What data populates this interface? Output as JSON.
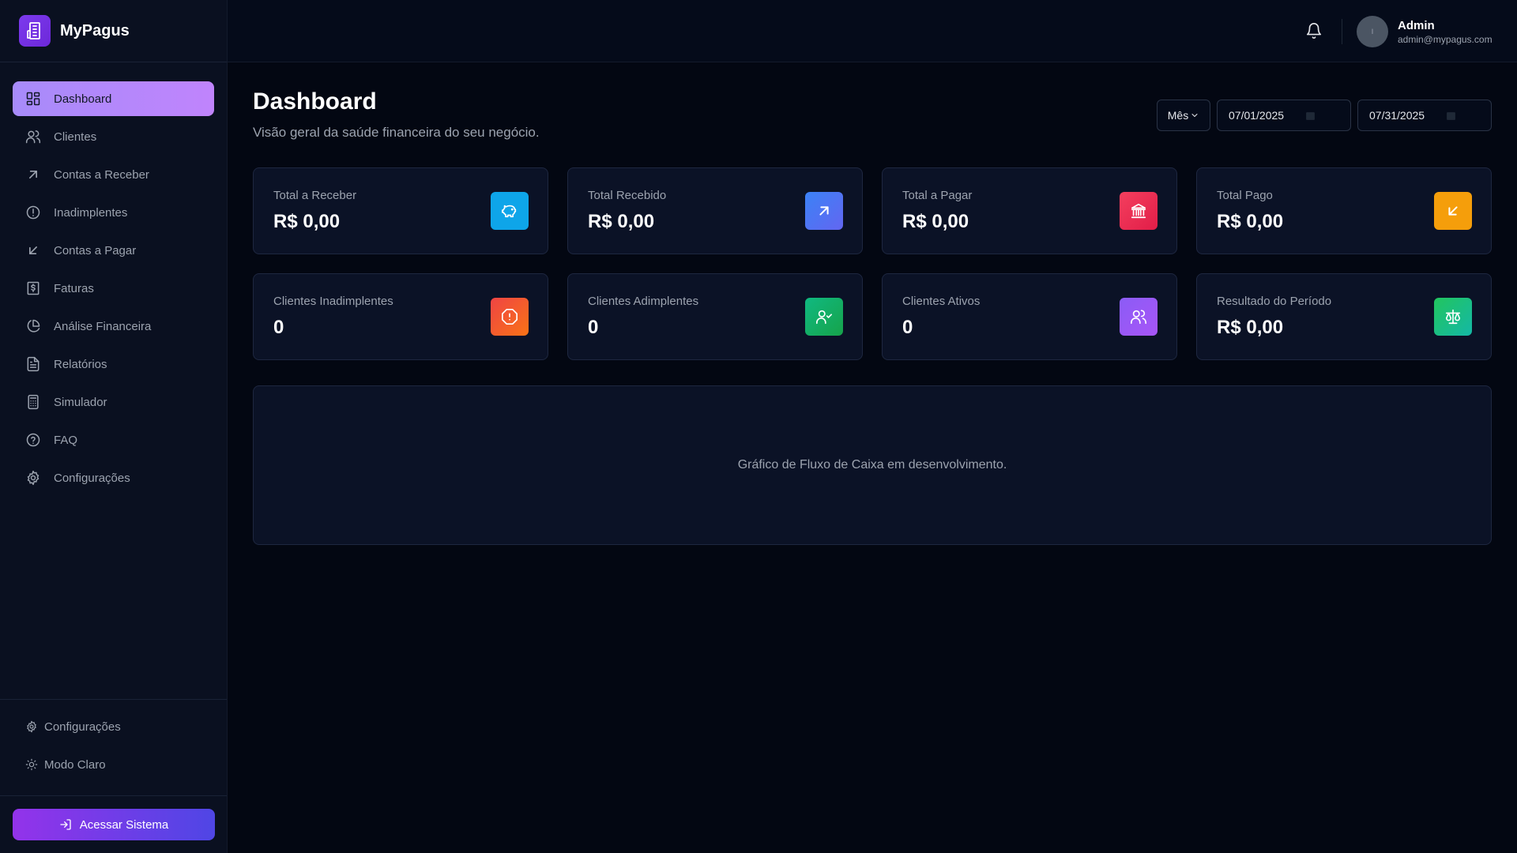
{
  "brand": {
    "name": "MyPagus",
    "icon": "building-icon"
  },
  "sidebar": {
    "items": [
      {
        "label": "Dashboard",
        "icon": "dashboard-icon",
        "active": true
      },
      {
        "label": "Clientes",
        "icon": "users-icon"
      },
      {
        "label": "Contas a Receber",
        "icon": "arrow-up-right-icon"
      },
      {
        "label": "Inadimplentes",
        "icon": "alert-circle-icon"
      },
      {
        "label": "Contas a Pagar",
        "icon": "arrow-down-left-icon"
      },
      {
        "label": "Faturas",
        "icon": "invoice-dollar-icon"
      },
      {
        "label": "Análise Financeira",
        "icon": "pie-chart-icon"
      },
      {
        "label": "Relatórios",
        "icon": "file-text-icon"
      },
      {
        "label": "Simulador",
        "icon": "calculator-icon"
      },
      {
        "label": "FAQ",
        "icon": "help-circle-icon"
      },
      {
        "label": "Configurações",
        "icon": "gear-icon"
      }
    ],
    "footer": [
      {
        "label": "Configurações",
        "icon": "gear-icon"
      },
      {
        "label": "Modo Claro",
        "icon": "sun-icon"
      }
    ],
    "access_button": "Acessar Sistema"
  },
  "header": {
    "user_name": "Admin",
    "user_email": "admin@mypagus.com",
    "avatar_text": "I"
  },
  "page": {
    "title": "Dashboard",
    "subtitle": "Visão geral da saúde financeira do seu negócio.",
    "period_select": "Mês",
    "date_start": "07/01/2025",
    "date_end": "07/31/2025"
  },
  "cards": [
    {
      "label": "Total a Receber",
      "value": "R$ 0,00",
      "icon": "piggy-bank-icon",
      "color": "#0ea5e9"
    },
    {
      "label": "Total Recebido",
      "value": "R$ 0,00",
      "icon": "arrow-up-right-icon",
      "color": "#4f6ef7"
    },
    {
      "label": "Total a Pagar",
      "value": "R$ 0,00",
      "icon": "bank-icon",
      "color": "#f43f5e"
    },
    {
      "label": "Total Pago",
      "value": "R$ 0,00",
      "icon": "arrow-down-left-icon",
      "color": "#f59e0b"
    },
    {
      "label": "Clientes Inadimplentes",
      "value": "0",
      "icon": "alert-octagon-icon",
      "color": "#f4512c"
    },
    {
      "label": "Clientes Adimplentes",
      "value": "0",
      "icon": "user-check-icon",
      "color": "#10b981"
    },
    {
      "label": "Clientes Ativos",
      "value": "0",
      "icon": "users-icon",
      "color": "#8b5cf6"
    },
    {
      "label": "Resultado do Período",
      "value": "R$ 0,00",
      "icon": "scale-icon",
      "color": "#10b981"
    }
  ],
  "chart_panel": {
    "message": "Gráfico de Fluxo de Caixa em desenvolvimento."
  }
}
